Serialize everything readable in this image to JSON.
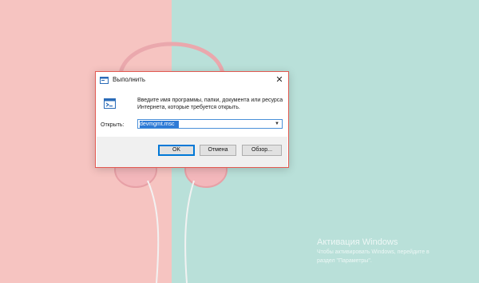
{
  "dialog": {
    "title": "Выполнить",
    "close_symbol": "✕",
    "description": "Введите имя программы, папки, документа или ресурса Интернета, которые требуется открыть.",
    "open_label": "Открыть:",
    "open_value": "devmgmt.msc",
    "buttons": {
      "ok": "OK",
      "cancel": "Отмена",
      "browse": "Обзор..."
    }
  },
  "watermark": {
    "title": "Активация Windows",
    "line1": "Чтобы активировать Windows, перейдите в",
    "line2": "раздел \"Параметры\"."
  },
  "icons": {
    "title": "run-dialog-icon",
    "body": "run-program-icon",
    "close": "close-icon",
    "dropdown": "chevron-down-icon"
  },
  "colors": {
    "wallpaper_left": "#f6c4c1",
    "wallpaper_right": "#b9e0d9",
    "dialog_border": "#e35a52",
    "accent": "#0078d7",
    "selection": "#2d7ad6"
  }
}
